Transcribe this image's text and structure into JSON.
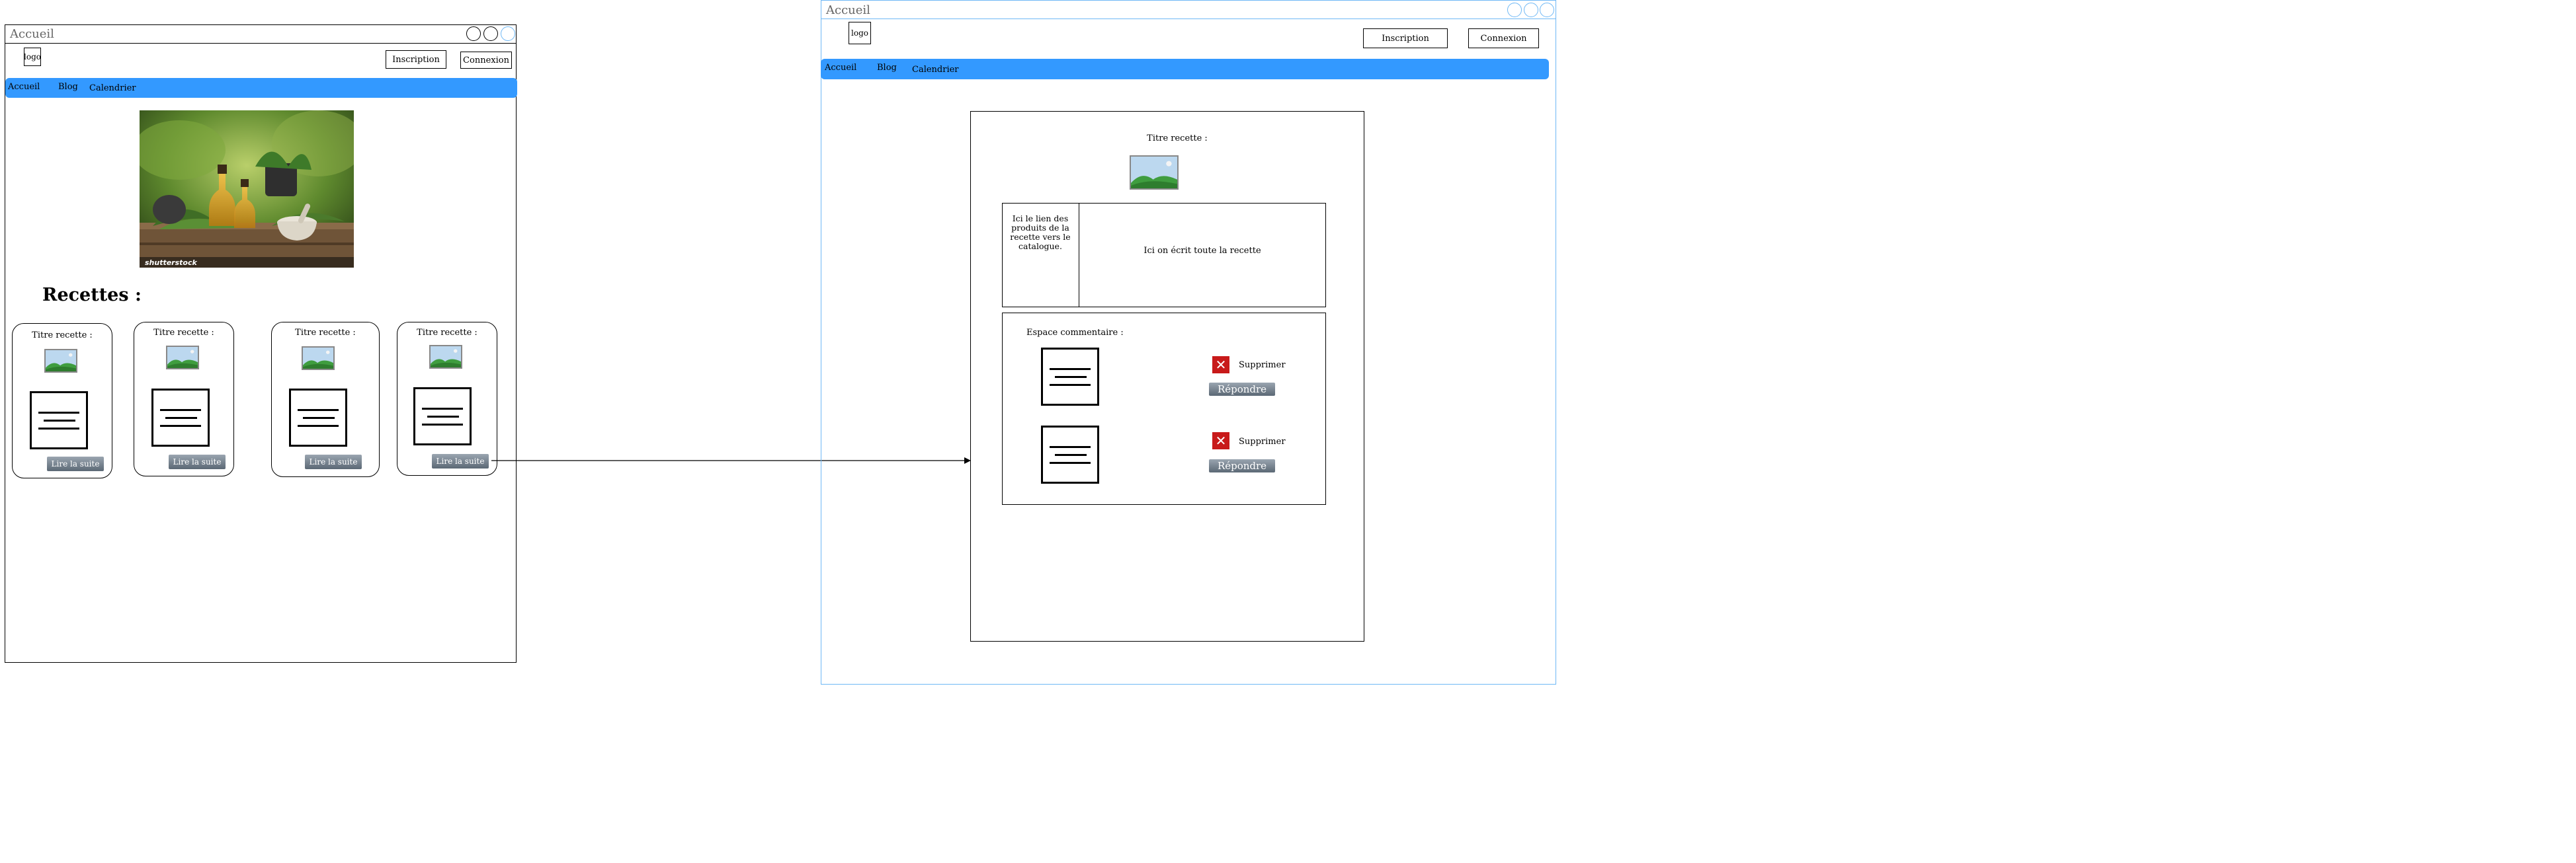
{
  "left_window": {
    "title": "Accueil",
    "logo": "logo",
    "signup_label": "Inscription",
    "login_label": "Connexion",
    "nav": [
      "Accueil",
      "Blog",
      "Calendrier"
    ],
    "hero_watermark": "shutterstock",
    "recipes_heading": "Recettes :",
    "cards": [
      {
        "title": "Titre recette :",
        "button": "Lire la suite"
      },
      {
        "title": "Titre recette :",
        "button": "Lire la suite"
      },
      {
        "title": "Titre recette :",
        "button": "Lire la suite"
      },
      {
        "title": "Titre recette :",
        "button": "Lire la suite"
      }
    ]
  },
  "right_window": {
    "title": "Accueil",
    "logo": "logo",
    "signup_label": "Inscription",
    "login_label": "Connexion",
    "nav": [
      "Accueil",
      "Blog",
      "Calendrier"
    ],
    "recipe_title": "Titre recette :",
    "product_link_text": "Ici le lien des produits de la recette vers le catalogue.",
    "recipe_text": "Ici on écrit toute la recette",
    "comments_label": "Espace commentaire :",
    "comments": [
      {
        "delete_label": "Supprimer",
        "reply_label": "Répondre"
      },
      {
        "delete_label": "Supprimer",
        "reply_label": "Répondre"
      }
    ]
  },
  "colors": {
    "nav_bar": "#3399ff",
    "right_window_border": "#6fb8f5",
    "delete_icon": "#c81a1a"
  }
}
